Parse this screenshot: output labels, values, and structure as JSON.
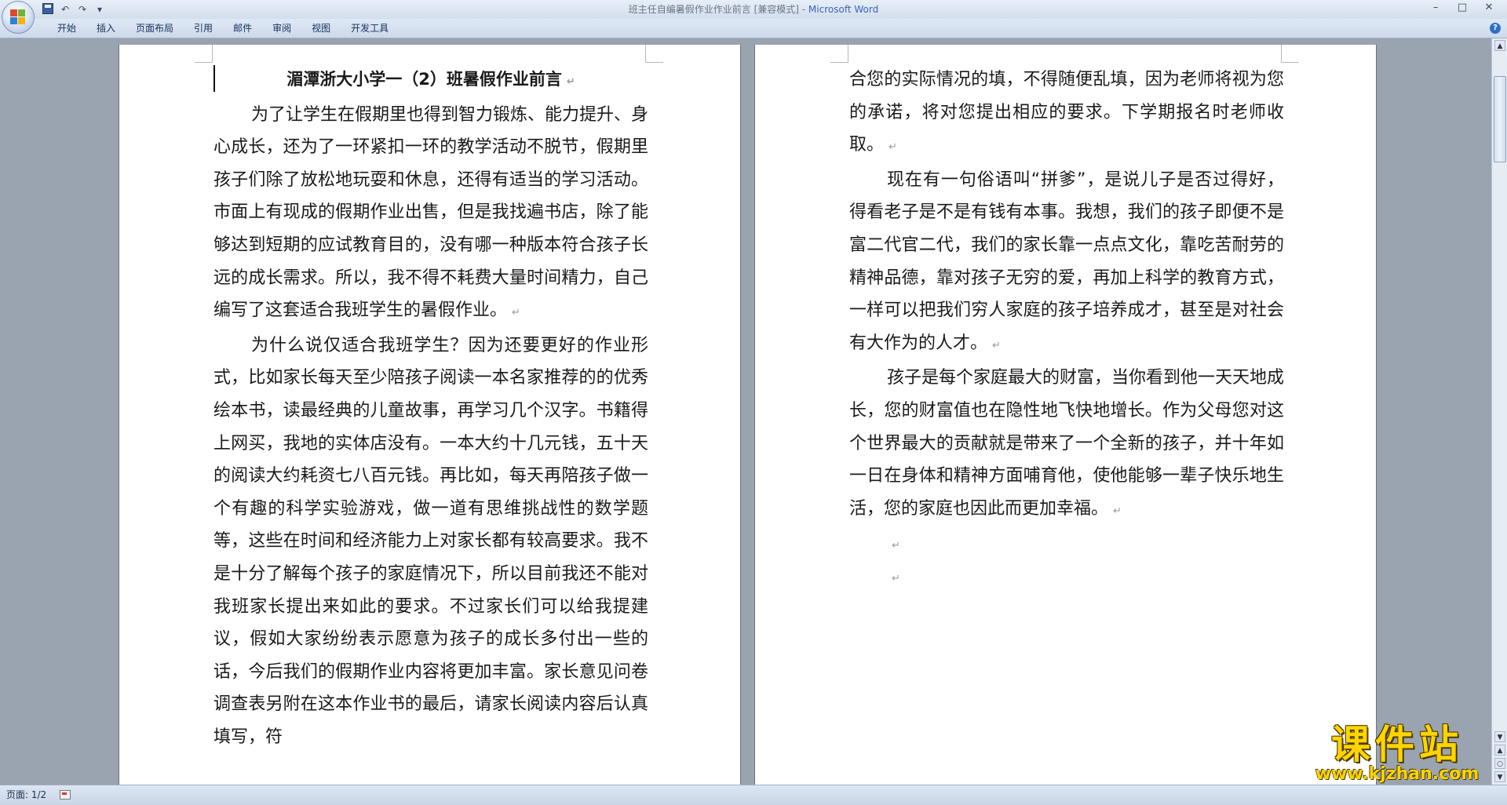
{
  "window": {
    "title": "班主任自编暑假作业作业前言 [兼容模式] - ",
    "app_name": "Microsoft Word",
    "controls": [
      "–",
      "□",
      "✕"
    ]
  },
  "quick_access": {
    "icons": [
      "save-icon",
      "undo-icon",
      "redo-icon",
      "customize-icon"
    ],
    "undo": "↶",
    "redo": "↷",
    "customize": "▾"
  },
  "ribbon": {
    "tabs": [
      "开始",
      "插入",
      "页面布局",
      "引用",
      "邮件",
      "审阅",
      "视图",
      "开发工具"
    ],
    "help": "?"
  },
  "document": {
    "page1": {
      "heading": "湄潭浙大小学一（2）班暑假作业前言",
      "paragraphs": [
        "为了让学生在假期里也得到智力锻炼、能力提升、身心成长，还为了一环紧扣一环的教学活动不脱节，假期里孩子们除了放松地玩耍和休息，还得有适当的学习活动。市面上有现成的假期作业出售，但是我找遍书店，除了能够达到短期的应试教育目的，没有哪一种版本符合孩子长远的成长需求。所以，我不得不耗费大量时间精力，自己编写了这套适合我班学生的暑假作业。",
        "为什么说仅适合我班学生？因为还要更好的作业形式，比如家长每天至少陪孩子阅读一本名家推荐的的优秀绘本书，读最经典的儿童故事，再学习几个汉字。书籍得上网买，我地的实体店没有。一本大约十几元钱，五十天的阅读大约耗资七八百元钱。再比如，每天再陪孩子做一个有趣的科学实验游戏，做一道有思维挑战性的数学题等，这些在时间和经济能力上对家长都有较高要求。我不是十分了解每个孩子的家庭情况下，所以目前我还不能对我班家长提出来如此的要求。不过家长们可以给我提建议，假如大家纷纷表示愿意为孩子的成长多付出一些的话，今后我们的假期作业内容将更加丰富。家长意见问卷调查表另附在这本作业书的最后，请家长阅读内容后认真填写，符"
      ]
    },
    "page2": {
      "paragraphs": [
        "合您的实际情况的填，不得随便乱填，因为老师将视为您的承诺，将对您提出相应的要求。下学期报名时老师收取。",
        "现在有一句俗语叫“拼爹”，是说儿子是否过得好，得看老子是不是有钱有本事。我想，我们的孩子即便不是富二代官二代，我们的家长靠一点点文化，靠吃苦耐劳的精神品德，靠对孩子无穷的爱，再加上科学的教育方式，一样可以把我们穷人家庭的孩子培养成才，甚至是对社会有大作为的人才。",
        "孩子是每个家庭最大的财富，当你看到他一天天地成长，您的财富值也在隐性地飞快地增长。作为父母您对这个世界最大的贡献就是带来了一个全新的孩子，并十年如一日在身体和精神方面哺育他，使他能够一辈子快乐地生活，您的家庭也因此而更加幸福。"
      ]
    },
    "paragraph_mark": "↵"
  },
  "scrollbar": {
    "up": "▲",
    "down": "▼",
    "prev_page": "▲",
    "browse": "○",
    "next_page": "▼"
  },
  "status": {
    "page": "页面: 1/2"
  },
  "watermark": {
    "title": "课件站",
    "url": "www.kjzhan.com"
  }
}
